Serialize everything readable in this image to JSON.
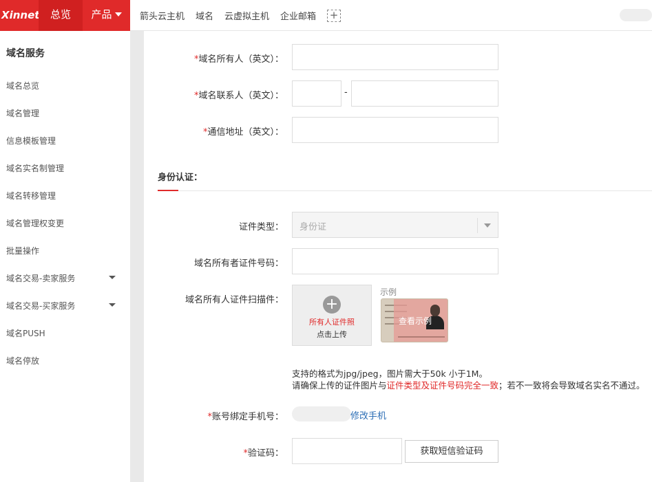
{
  "topbar": {
    "logo": "Xinnet",
    "home_label": "总览",
    "products_label": "产品",
    "quick_links": [
      "箭头云主机",
      "域名",
      "云虚拟主机",
      "企业邮箱"
    ],
    "add_symbol": "+"
  },
  "sidebar": {
    "title": "域名服务",
    "items": [
      {
        "label": "域名总览"
      },
      {
        "label": "域名管理"
      },
      {
        "label": "信息模板管理"
      },
      {
        "label": "域名实名制管理"
      },
      {
        "label": "域名转移管理"
      },
      {
        "label": "域名管理权变更"
      },
      {
        "label": "批量操作"
      },
      {
        "label": "域名交易-卖家服务"
      },
      {
        "label": "域名交易-买家服务"
      },
      {
        "label": "域名PUSH"
      },
      {
        "label": "域名停放"
      }
    ]
  },
  "form": {
    "owner_en_label": "域名所有人（英文）：",
    "contact_en_label": "域名联系人（英文）：",
    "address_en_label": "通信地址（英文）：",
    "contact_separator": "-",
    "identity_section_title": "身份认证：",
    "id_type_label": "证件类型：",
    "id_type_value": "身份证",
    "id_number_label": "域名所有者证件号码：",
    "scan_label": "域名所有人证件扫描件：",
    "upload_line1": "所有人证件照",
    "upload_line2": "点击上传",
    "example_label": "示例",
    "view_example": "查看示例",
    "note_line1": "支持的格式为jpg/jpeg，图片需大于50k 小于1M。",
    "note_line2_prefix": "请确保上传的证件图片与",
    "note_line2_highlight": "证件类型及证件号码完全一致",
    "note_line2_suffix": "；若不一致将会导致域名实名不通过。",
    "phone_label": "账号绑定手机号：",
    "change_phone_link": "修改手机",
    "code_label": "验证码：",
    "get_code_button": "获取短信验证码",
    "required_mark": "*"
  },
  "colors": {
    "brand_red": "#e02a2a",
    "link_blue": "#2a6db5"
  }
}
